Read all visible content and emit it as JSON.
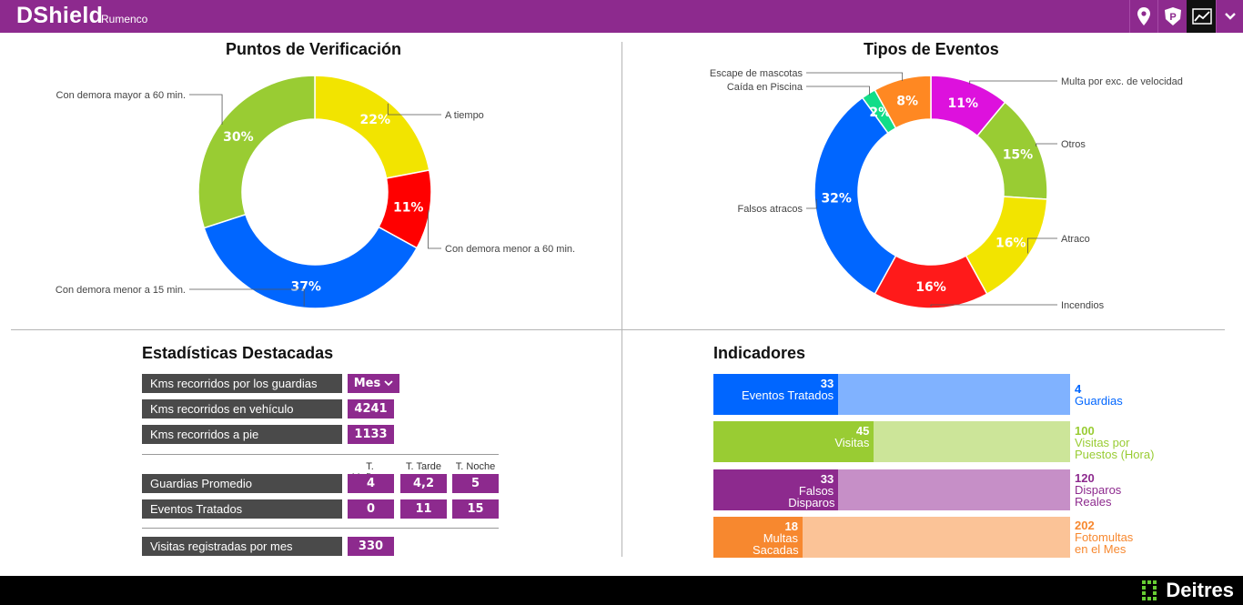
{
  "app": {
    "brand": "DShield",
    "client": "Rumenco"
  },
  "toolbar": {
    "icons": [
      "map-pin-icon",
      "parking-icon",
      "chart-line-icon",
      "chevron-down-icon"
    ]
  },
  "colors": {
    "brand": "#8d2a8e",
    "dark_label": "#4a4a4a"
  },
  "chart_data": [
    {
      "type": "pie",
      "title": "Puntos de Verificación",
      "slices": [
        {
          "label": "A tiempo",
          "value": 22,
          "display": "22%",
          "color": "#f2e400"
        },
        {
          "label": "Con demora menor a  60 min.",
          "value": 11,
          "display": "11%",
          "color": "#ff0000"
        },
        {
          "label": "Con demora menor a  15 min.",
          "value": 37,
          "display": "37%",
          "color": "#0066ff"
        },
        {
          "label": "Con demora mayor a  60 min.",
          "value": 30,
          "display": "30%",
          "color": "#99cc33"
        }
      ]
    },
    {
      "type": "pie",
      "title": "Tipos de Eventos",
      "slices": [
        {
          "label": "Multa por exc. de velocidad",
          "value": 11,
          "display": "11%",
          "color": "#dd11dd"
        },
        {
          "label": "Otros",
          "value": 15,
          "display": "15%",
          "color": "#99cc33"
        },
        {
          "label": "Atraco",
          "value": 16,
          "display": "16%",
          "color": "#f2e400"
        },
        {
          "label": "Incendios",
          "value": 16,
          "display": "16%",
          "color": "#ff1a1a"
        },
        {
          "label": "Falsos atracos",
          "value": 32,
          "display": "32%",
          "color": "#0066ff"
        },
        {
          "label": "Caída en Piscina",
          "value": 2,
          "display": "2%",
          "color": "#11dd88"
        },
        {
          "label": "Escape de mascotas",
          "value": 8,
          "display": "8%",
          "color": "#ff8822"
        }
      ]
    }
  ],
  "stats": {
    "title": "Estadísticas Destacadas",
    "kms_guardias": {
      "label": "Kms recorridos por los guardias",
      "select": "Mes"
    },
    "kms_vehiculo": {
      "label": "Kms recorridos en vehículo",
      "value": "4241"
    },
    "kms_pie": {
      "label": "Kms recorridos a pie",
      "value": "1133"
    },
    "shift_headers": [
      "T. Mañana",
      "T. Tarde",
      "T. Noche"
    ],
    "guardias_promedio": {
      "label": "Guardias Promedio",
      "values": [
        "4",
        "4,2",
        "5"
      ]
    },
    "eventos_tratados": {
      "label": "Eventos Tratados",
      "values": [
        "0",
        "11",
        "15"
      ]
    },
    "visitas": {
      "label": "Visitas registradas por mes",
      "value": "330"
    }
  },
  "indicators": {
    "title": "Indicadores",
    "rows": [
      {
        "value": "33",
        "text": "Eventos Tratados",
        "total": "4",
        "total_text": "Guardias",
        "fraction": 0.35,
        "dark": "#0066ff",
        "light": "#80b2ff"
      },
      {
        "value": "45",
        "text": "Visitas",
        "total": "100",
        "total_text": "Visitas por Puestos (Hora)",
        "fraction": 0.45,
        "dark": "#99cc33",
        "light": "#cce599"
      },
      {
        "value": "33",
        "text": "Falsos Disparos",
        "total": "120",
        "total_text": "Disparos Reales",
        "fraction": 0.35,
        "dark": "#8d2a8e",
        "light": "#c68fc7"
      },
      {
        "value": "18",
        "text": "Multas Sacadas",
        "total": "202",
        "total_text": "Fotomultas en el Mes",
        "fraction": 0.25,
        "dark": "#f7882f",
        "light": "#fbc397"
      }
    ]
  },
  "footer": {
    "logo": "Deitres"
  }
}
